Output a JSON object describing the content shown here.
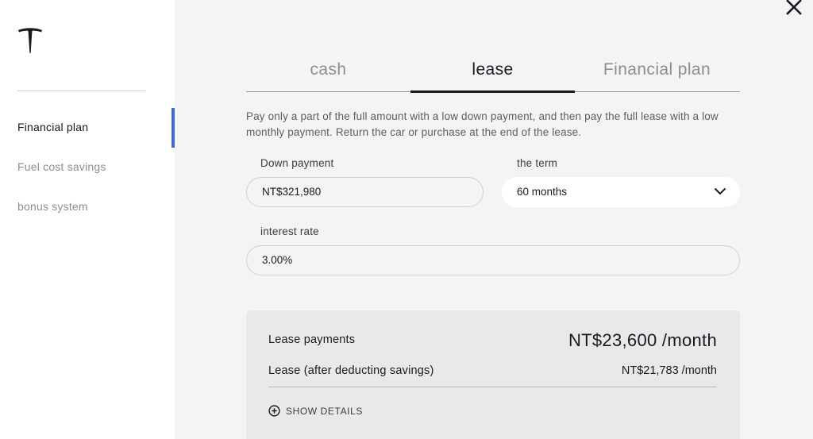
{
  "sidebar": {
    "logo": "tesla-logo",
    "items": [
      {
        "label": "Financial plan",
        "active": true
      },
      {
        "label": "Fuel cost savings",
        "active": false
      },
      {
        "label": "bonus system",
        "active": false
      }
    ],
    "accent_color": "#3e6ae1"
  },
  "close": {
    "icon": "close-icon"
  },
  "tabs": [
    {
      "label": "cash",
      "active": false
    },
    {
      "label": "lease",
      "active": true
    },
    {
      "label": "Financial plan",
      "active": false
    }
  ],
  "description": "Pay only a part of the full amount with a low down payment, and then pay the full lease with a low monthly payment. Return the car or purchase at the end of the lease.",
  "form": {
    "down_payment": {
      "label": "Down payment",
      "value": "NT$321,980"
    },
    "term": {
      "label": "the term",
      "value": "60 months",
      "icon": "chevron-down-icon"
    },
    "interest_rate": {
      "label": "interest rate",
      "value": "3.00%"
    }
  },
  "summary": {
    "lease_payments": {
      "label": "Lease payments",
      "value": "NT$23,600 /month"
    },
    "lease_after_savings": {
      "label": "Lease (after deducting savings)",
      "value": "NT$21,783 /month"
    },
    "show_details": {
      "label": "SHOW DETAILS",
      "icon": "plus-circle-icon"
    }
  }
}
